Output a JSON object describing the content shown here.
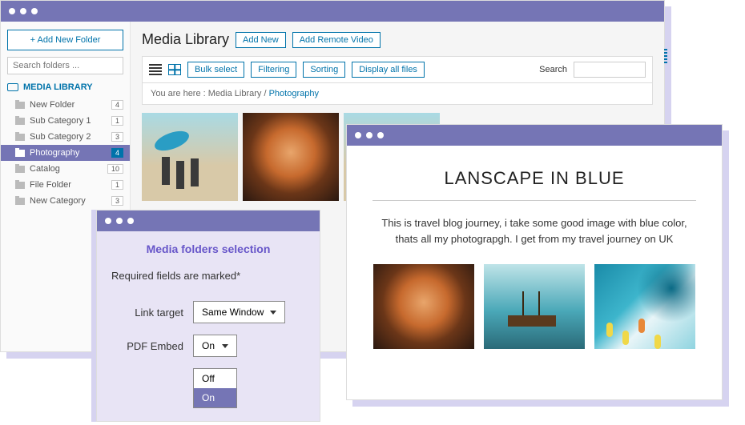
{
  "main": {
    "sidebar": {
      "add_folder_btn": "+   Add New Folder",
      "search_placeholder": "Search folders ...",
      "heading": "MEDIA LIBRARY",
      "folders": [
        {
          "name": "New Folder",
          "count": "4",
          "active": false
        },
        {
          "name": "Sub Category 1",
          "count": "1",
          "active": false
        },
        {
          "name": "Sub Category 2",
          "count": "3",
          "active": false
        },
        {
          "name": "Photography",
          "count": "4",
          "active": true
        },
        {
          "name": "Catalog",
          "count": "10",
          "active": false
        },
        {
          "name": "File Folder",
          "count": "1",
          "active": false
        },
        {
          "name": "New Category",
          "count": "3",
          "active": false
        }
      ]
    },
    "content": {
      "title": "Media Library",
      "add_new": "Add New",
      "add_remote": "Add Remote Video",
      "toolbar": {
        "bulk_select": "Bulk select",
        "filtering": "Filtering",
        "sorting": "Sorting",
        "display_all": "Display all files",
        "search_label": "Search"
      },
      "breadcrumb": {
        "prefix": "You are here  :  ",
        "root": "Media Library",
        "sep": "  /  ",
        "current": "Photography"
      }
    }
  },
  "modal": {
    "title": "Media folders selection",
    "required_text": "Required fields are marked*",
    "link_target": {
      "label": "Link target",
      "value": "Same Window"
    },
    "pdf_embed": {
      "label": "PDF Embed",
      "value": "On",
      "options": [
        "Off",
        "On"
      ],
      "selected": "On"
    }
  },
  "blog": {
    "title": "LANSCAPE IN BLUE",
    "text": "This is travel blog journey, i take some good image with blue color, thats all my photograpgh. I get from my travel journey on UK"
  }
}
